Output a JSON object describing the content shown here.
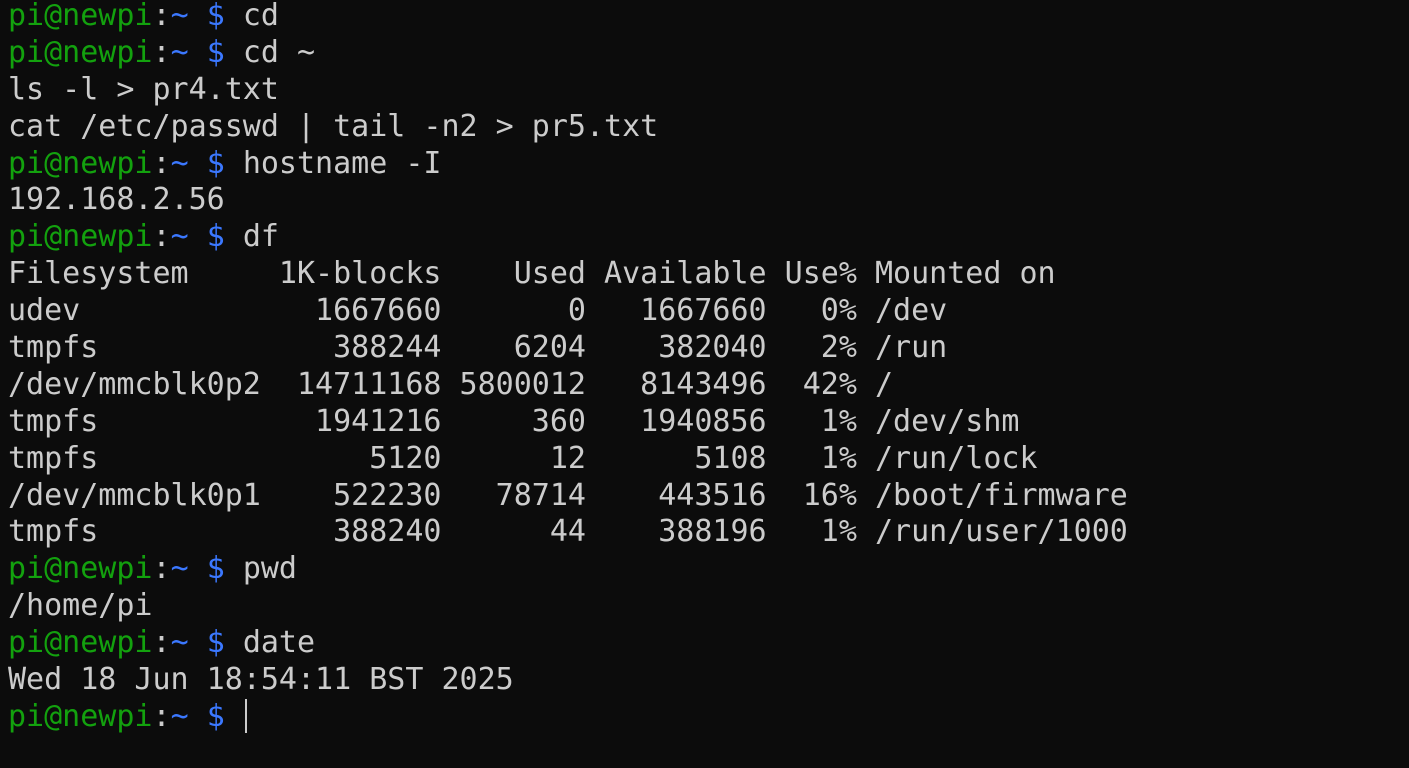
{
  "prompt": {
    "user_host": "pi@newpi",
    "colon": ":",
    "path": "~",
    "symbol": "$"
  },
  "lines": [
    {
      "type": "prompt",
      "command": "cd"
    },
    {
      "type": "prompt",
      "command": "cd ~"
    },
    {
      "type": "output",
      "text": "ls -l > pr4.txt"
    },
    {
      "type": "output",
      "text": "cat /etc/passwd | tail -n2 > pr5.txt"
    },
    {
      "type": "prompt",
      "command": "hostname -I"
    },
    {
      "type": "output",
      "text": "192.168.2.56"
    },
    {
      "type": "prompt",
      "command": "df"
    },
    {
      "type": "output",
      "text": "Filesystem     1K-blocks    Used Available Use% Mounted on"
    },
    {
      "type": "output",
      "text": "udev             1667660       0   1667660   0% /dev"
    },
    {
      "type": "output",
      "text": "tmpfs             388244    6204    382040   2% /run"
    },
    {
      "type": "output",
      "text": "/dev/mmcblk0p2  14711168 5800012   8143496  42% /"
    },
    {
      "type": "output",
      "text": "tmpfs            1941216     360   1940856   1% /dev/shm"
    },
    {
      "type": "output",
      "text": "tmpfs               5120      12      5108   1% /run/lock"
    },
    {
      "type": "output",
      "text": "/dev/mmcblk0p1    522230   78714    443516  16% /boot/firmware"
    },
    {
      "type": "output",
      "text": "tmpfs             388240      44    388196   1% /run/user/1000"
    },
    {
      "type": "prompt",
      "command": "pwd"
    },
    {
      "type": "output",
      "text": "/home/pi"
    },
    {
      "type": "prompt",
      "command": "date"
    },
    {
      "type": "output",
      "text": "Wed 18 Jun 18:54:11 BST 2025"
    },
    {
      "type": "prompt",
      "command": "",
      "cursor": true
    }
  ]
}
